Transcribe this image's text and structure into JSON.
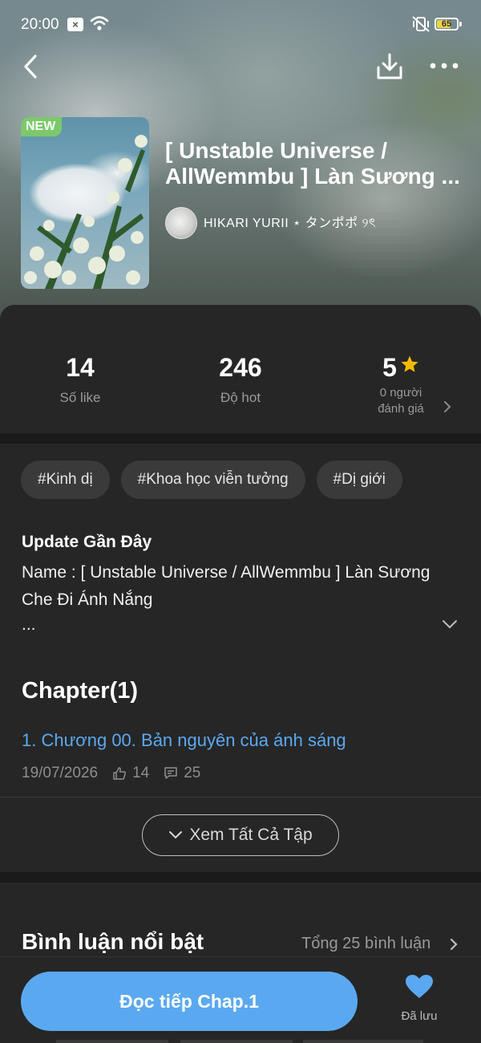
{
  "status_bar": {
    "time": "20:00",
    "battery": "65"
  },
  "book": {
    "badge": "NEW",
    "title": "[ Unstable Universe / AllWemmbu ] Làn Sương ...",
    "author": "HIKARI YURII ⋆ タンポポ ୨ৎ"
  },
  "stats": {
    "likes_value": "14",
    "likes_label": "Số like",
    "hot_value": "246",
    "hot_label": "Độ hot",
    "rating_value": "5",
    "rating_label_line1": "0 người",
    "rating_label_line2": "đánh giá"
  },
  "tags": [
    "#Kinh dị",
    "#Khoa học viễn tưởng",
    "#Dị giới"
  ],
  "update": {
    "title": "Update Gần Đây",
    "text": "Name : [ Unstable Universe / AllWemmbu ] Làn Sương Che Đi Ánh Nắng",
    "ellipsis": "..."
  },
  "chapters": {
    "heading": "Chapter(1)",
    "items": [
      {
        "title": "1. Chương 00. Bản nguyên của ánh sáng",
        "date": "19/07/2026",
        "likes": "14",
        "comments": "25"
      }
    ],
    "view_all_label": "Xem Tất Cả Tập"
  },
  "comments": {
    "title": "Bình luận nổi bật",
    "total": "Tổng 25 bình luận"
  },
  "bottom": {
    "read_button": "Đọc tiếp Chap.1",
    "saved_label": "Đã lưu"
  },
  "colors": {
    "accent": "#5aa9f0",
    "badge_new": "#7bc96b",
    "star": "#f5b800",
    "background": "#262626"
  }
}
